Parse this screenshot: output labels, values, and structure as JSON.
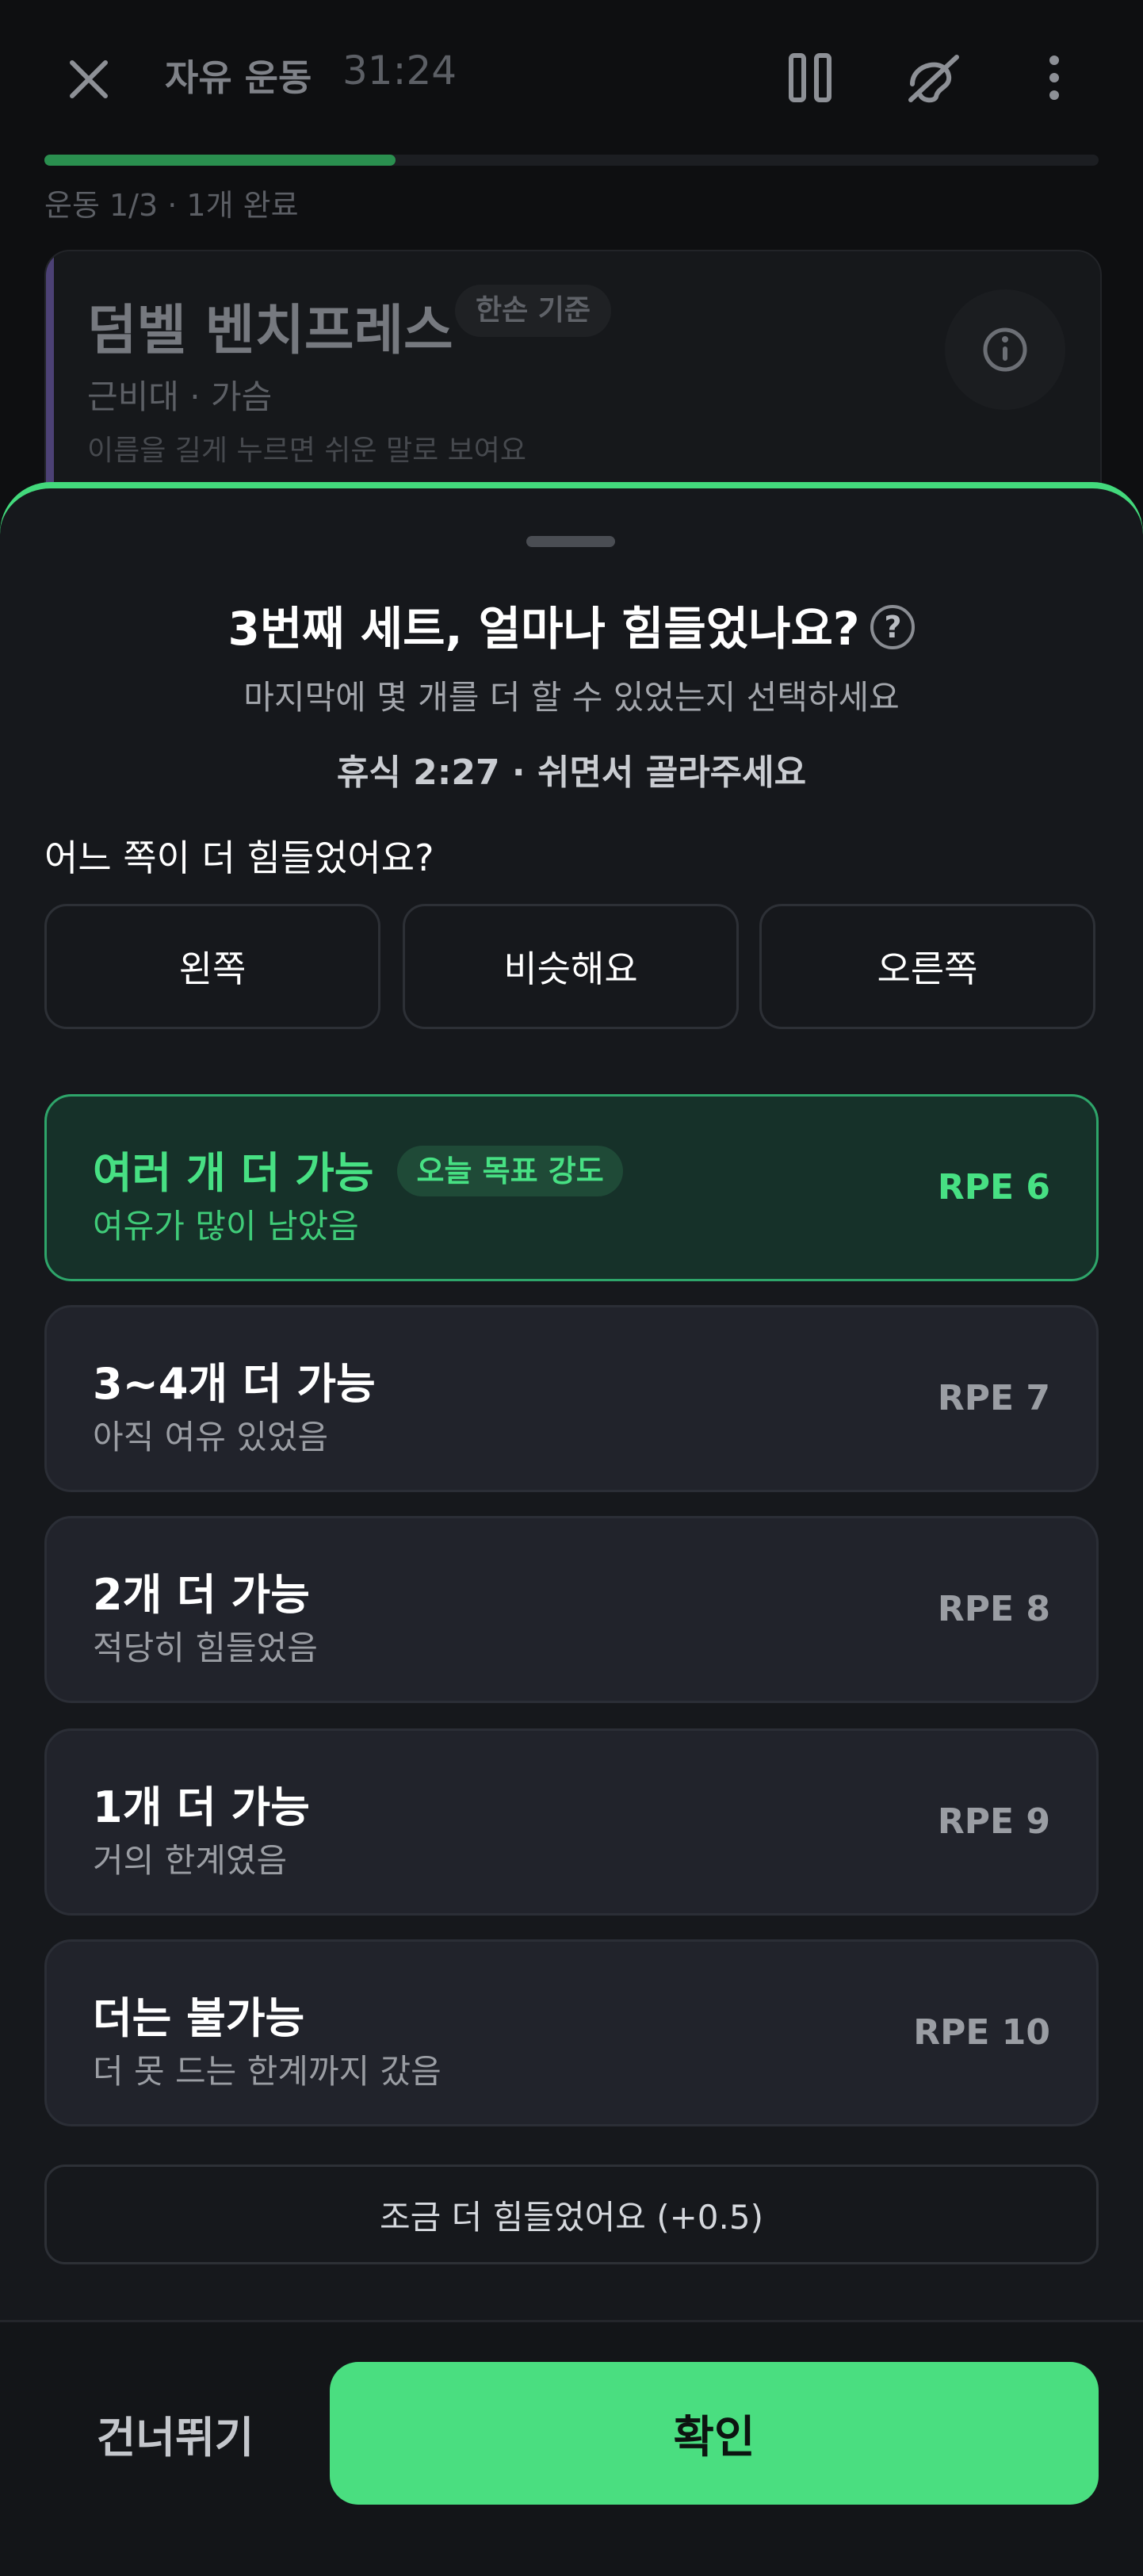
{
  "header": {
    "title": "자유 운동",
    "timer": "31:24",
    "icons": [
      "close-icon",
      "pause-icon",
      "mute-icon",
      "more-icon"
    ]
  },
  "progress": {
    "label": "운동 1/3 · 1개 완료",
    "fraction": 0.333
  },
  "exercise": {
    "name": "덤벨 벤치프레스",
    "badge": "한손 기준",
    "muscles": "근비대 · 가슴",
    "hint": "이름을 길게 누르면 쉬운 말로 보여요"
  },
  "sheet": {
    "title": "3번째 세트, 얼마나 힘들었나요?",
    "help_glyph": "?",
    "subtitle": "마지막에 몇 개를 더 할 수 있었는지 선택하세요",
    "rest": "휴식 2:27 · 쉬면서 골라주세요",
    "side_question": "어느 쪽이 더 힘들었어요?",
    "side_options": [
      "왼쪽",
      "비슷해요",
      "오른쪽"
    ],
    "rpe_options": [
      {
        "label": "여러 개 더 가능",
        "desc": "여유가 많이 남았음",
        "rpe": "RPE 6",
        "badge": "오늘 목표 강도",
        "selected": true
      },
      {
        "label": "3~4개 더 가능",
        "desc": "아직 여유 있었음",
        "rpe": "RPE 7"
      },
      {
        "label": "2개 더 가능",
        "desc": "적당히 힘들었음",
        "rpe": "RPE 8"
      },
      {
        "label": "1개 더 가능",
        "desc": "거의 한계였음",
        "rpe": "RPE 9"
      },
      {
        "label": "더는 불가능",
        "desc": "더 못 드는 한계까지 갔음",
        "rpe": "RPE 10"
      }
    ],
    "harder_button": "조금 더 힘들었어요 (+0.5)",
    "skip_button": "건너뛰기",
    "confirm_button": "확인"
  },
  "colors": {
    "accent": "#4ade80",
    "background": "#0e0f11",
    "sheet": "#16181c"
  }
}
